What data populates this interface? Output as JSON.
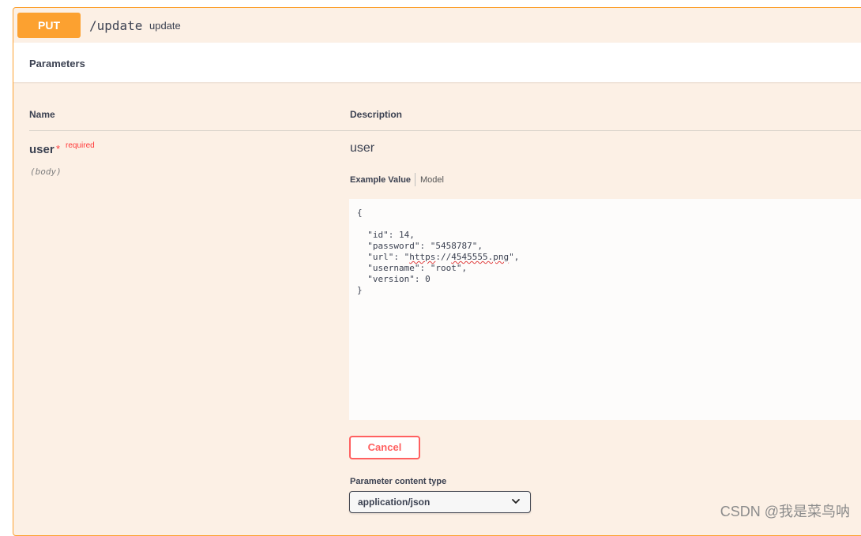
{
  "operation": {
    "method": "PUT",
    "path": "/update",
    "summary": "update"
  },
  "parameters_section": {
    "title": "Parameters",
    "columns": {
      "name": "Name",
      "description": "Description"
    },
    "param": {
      "name": "user",
      "required_mark": "*",
      "required_label": "required",
      "location": "(body)",
      "description": "user"
    }
  },
  "example": {
    "tabs": {
      "example_value": "Example Value",
      "model": "Model"
    },
    "body": {
      "open": "{",
      "lines": [
        "\"id\": 14,",
        "\"password\": \"5458787\",",
        "\"username\": \"root\",",
        "\"version\": 0"
      ],
      "url_line": {
        "key": "\"url\": \"",
        "spell_a": "https",
        "mid": "://",
        "spell_b": "4545555.png",
        "end": "\","
      },
      "close": "}"
    }
  },
  "cancel_button": "Cancel",
  "content_type": {
    "label": "Parameter content type",
    "selected": "application/json",
    "icon": "chevron-down-icon"
  },
  "watermark": "CSDN @我是菜鸟呐",
  "colors": {
    "put": "#fca130",
    "cancel": "#ff6060",
    "required": "#ff3939"
  }
}
